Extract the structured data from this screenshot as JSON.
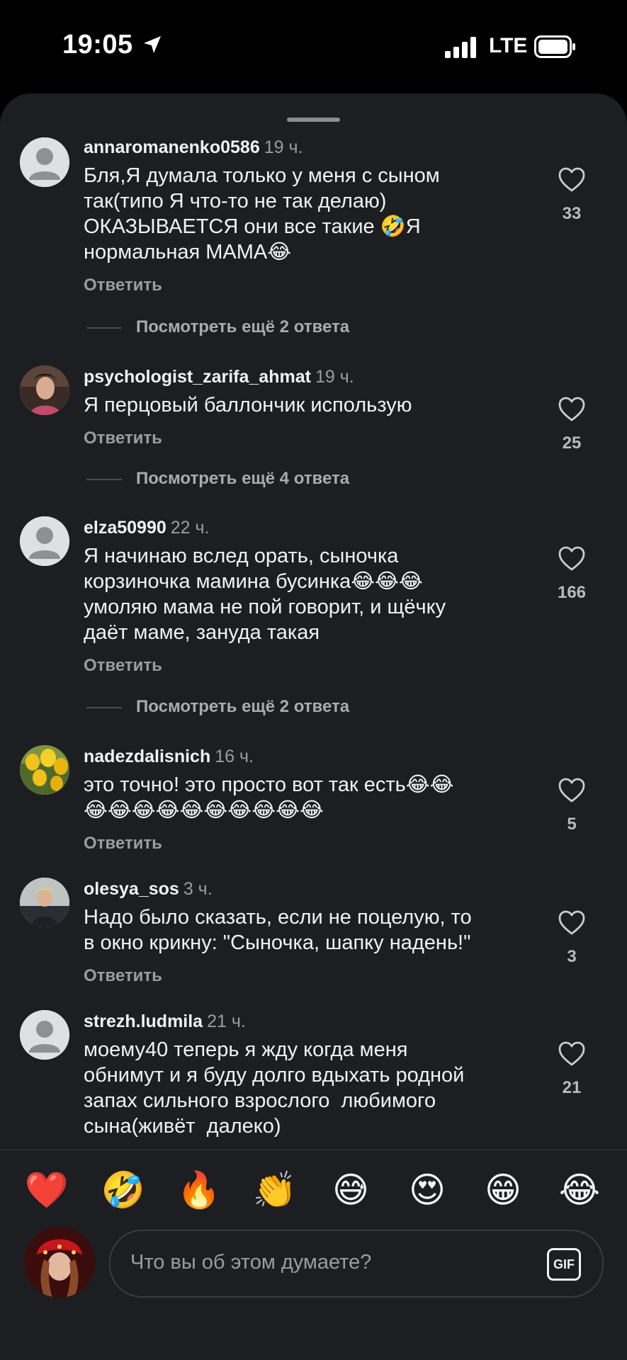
{
  "status_bar": {
    "time": "19:05",
    "network": "LTE"
  },
  "comments": [
    {
      "username": "annaromanenko0586",
      "time": "19 ч.",
      "text": "Бля,Я думала только у меня с сыном\nтак(типо Я что-то не так делаю)\nОКАЗЫВАЕТСЯ они все такие 🤣Я\nнормальная МАМА😂",
      "likes": "33",
      "reply_label": "Ответить",
      "more_replies": "Посмотреть ещё 2 ответа"
    },
    {
      "username": "psychologist_zarifa_ahmat",
      "time": "19 ч.",
      "text": "Я перцовый баллончик использую",
      "likes": "25",
      "reply_label": "Ответить",
      "more_replies": "Посмотреть ещё 4 ответа"
    },
    {
      "username": "elza50990",
      "time": "22 ч.",
      "text": "Я начинаю вслед орать, сыночка\nкорзиночка мамина бусинка😂😂😂\nумоляю мама не пой говорит, и щёчку\nдаёт маме, зануда такая",
      "likes": "166",
      "reply_label": "Ответить",
      "more_replies": "Посмотреть ещё 2 ответа"
    },
    {
      "username": "nadezdalisnich",
      "time": "16 ч.",
      "text": "это точно! это просто вот так есть😂😂\n😂😂😂😂😂😂😂😂😂😂",
      "likes": "5",
      "reply_label": "Ответить"
    },
    {
      "username": "olesya_sos",
      "time": "3 ч.",
      "text": "Надо было сказать, если не поцелую, то\nв окно крикну: \"Сыночка, шапку надень!\"",
      "likes": "3",
      "reply_label": "Ответить"
    },
    {
      "username": "strezh.ludmila",
      "time": "21 ч.",
      "text": "моему40 теперь я жду когда меня\nобнимут и я буду долго вдыхать родной\nзапах сильного взрослого  любимого\nсына(живёт  далеко)",
      "likes": "21"
    }
  ],
  "reactions": [
    "❤️",
    "🤣",
    "🔥",
    "👏",
    "😅",
    "😍",
    "😁",
    "😂"
  ],
  "composer": {
    "placeholder": "Что вы об этом думаете?",
    "gif_label": "GIF"
  },
  "colors": {
    "background": "#000000",
    "sheet": "#1c1e21",
    "muted_text": "#9a9ca0",
    "heart_red": "#e8202f"
  }
}
